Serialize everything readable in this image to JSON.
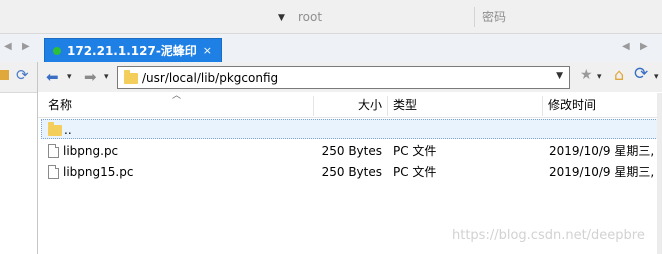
{
  "login": {
    "user": "root",
    "password_placeholder": "密码"
  },
  "tab": {
    "label": "172.21.1.127-泥蜂印",
    "close": "×",
    "status_color": "#2cc03a"
  },
  "toolbar": {
    "back": "⬅",
    "forward": "➡",
    "dropdown": "▾",
    "star": "★",
    "home": "⌂",
    "refresh": "⟳"
  },
  "address": {
    "path": "/usr/local/lib/pkgconfig"
  },
  "columns": [
    "名称",
    "大小",
    "类型",
    "修改时间"
  ],
  "files": [
    {
      "name": "..",
      "size": "",
      "type": "",
      "modified": "",
      "icon": "folder-icon"
    },
    {
      "name": "libpng.pc",
      "size": "250 Bytes",
      "type": "PC 文件",
      "modified": "2019/10/9 星期三, ",
      "icon": "file-icon"
    },
    {
      "name": "libpng15.pc",
      "size": "250 Bytes",
      "type": "PC 文件",
      "modified": "2019/10/9 星期三, ",
      "icon": "file-icon"
    }
  ],
  "watermark": "https://blog.csdn.net/deepbre",
  "colors": {
    "tab_active": "#1e80e4",
    "selection": "#e9f3fd",
    "folder": "#f4ce5b"
  }
}
